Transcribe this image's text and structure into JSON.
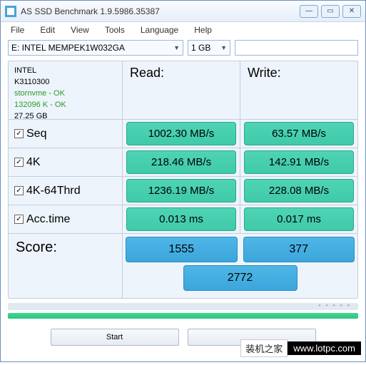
{
  "title": "AS SSD Benchmark 1.9.5986.35387",
  "menu": {
    "file": "File",
    "edit": "Edit",
    "view": "View",
    "tools": "Tools",
    "language": "Language",
    "help": "Help"
  },
  "toolbar": {
    "drive": "E: INTEL MEMPEK1W032GA",
    "size": "1 GB"
  },
  "info": {
    "vendor": "INTEL",
    "model": "K3110300",
    "driver": "stornvme - OK",
    "partition": "132096 K - OK",
    "capacity": "27.25 GB"
  },
  "headers": {
    "read": "Read:",
    "write": "Write:"
  },
  "tests": {
    "seq": {
      "label": "Seq",
      "checked": true,
      "read": "1002.30 MB/s",
      "write": "63.57 MB/s"
    },
    "k4": {
      "label": "4K",
      "checked": true,
      "read": "218.46 MB/s",
      "write": "142.91 MB/s"
    },
    "k4_64": {
      "label": "4K-64Thrd",
      "checked": true,
      "read": "1236.19 MB/s",
      "write": "228.08 MB/s"
    },
    "acc": {
      "label": "Acc.time",
      "checked": true,
      "read": "0.013 ms",
      "write": "0.017 ms"
    }
  },
  "score": {
    "label": "Score:",
    "read": "1555",
    "write": "377",
    "total": "2772"
  },
  "buttons": {
    "start": "Start",
    "abort": ""
  },
  "watermark": {
    "zh": "装机之家",
    "url": "www.lotpc.com"
  }
}
